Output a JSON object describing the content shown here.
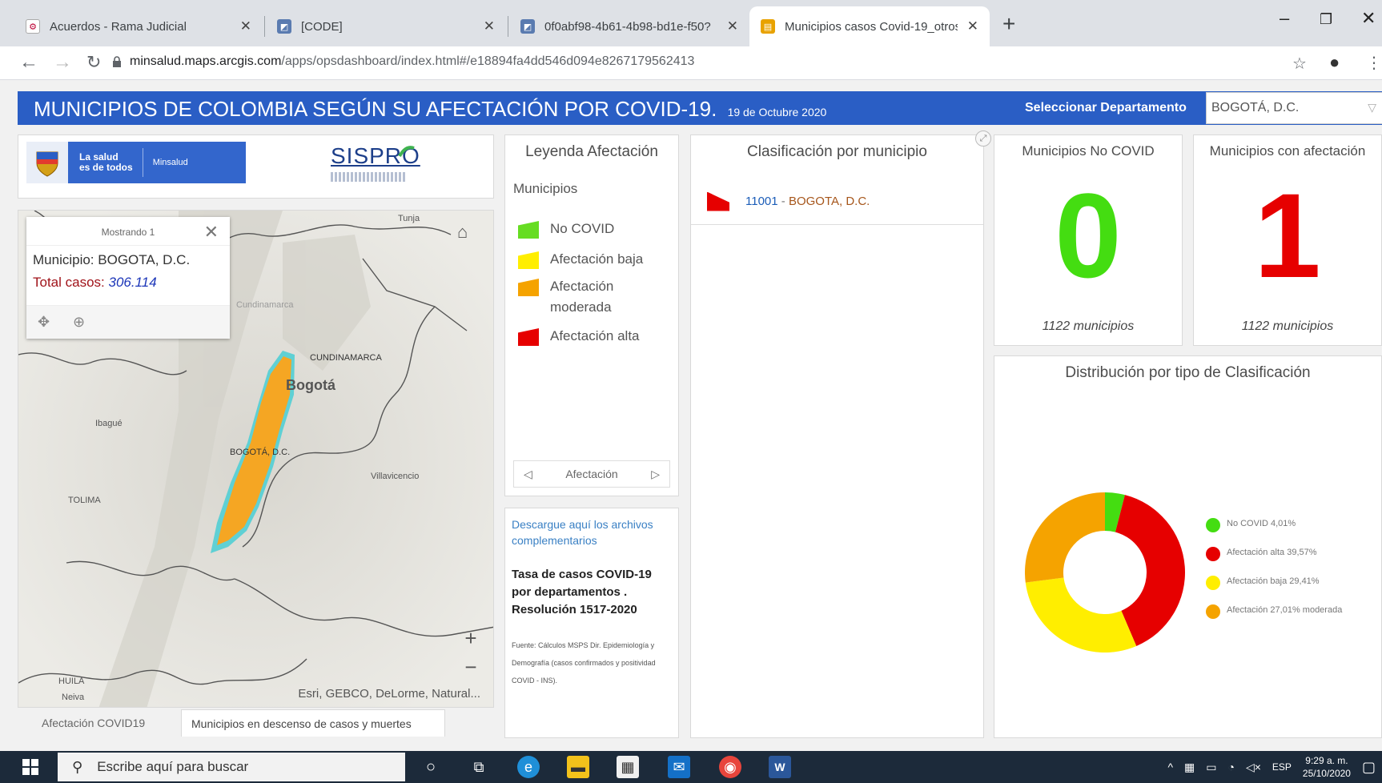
{
  "browser": {
    "tabs": [
      {
        "title": "Acuerdos - Rama Judicial"
      },
      {
        "title": "[CODE]"
      },
      {
        "title": "0f0abf98-4b61-4b98-bd1e-f50?"
      },
      {
        "title": "Municipios casos Covid-19_otros"
      }
    ],
    "url_host": "minsalud.maps.arcgis.com",
    "url_path": "/apps/opsdashboard/index.html#/e18894fa4dd546d094e8267179562413"
  },
  "header": {
    "title": "MUNICIPIOS DE COLOMBIA SEGÚN SU AFECTACIÓN POR COVID-19.",
    "date": "19 de Octubre 2020",
    "dept_label": "Seleccionar Departamento",
    "dept_value": "BOGOTÁ, D.C."
  },
  "logos": {
    "minsalud_line1": "La salud",
    "minsalud_line2": "es de todos",
    "minsalud_brand": "Minsalud",
    "sispro": "SISPRO"
  },
  "popup": {
    "header": "Mostrando 1",
    "municipio": "Municipio: BOGOTA, D.C.",
    "cases_label": "Total casos:",
    "cases_value": "306.114"
  },
  "map": {
    "labels": [
      "Tunja",
      "Cundinamarca",
      "CUNDINAMARCA",
      "Bogotá",
      "BOGOTÁ, D.C.",
      "Villavicencio",
      "Ibagué",
      "TOLIMA",
      "HUILA",
      "Neiva"
    ],
    "attribution": "Esri, GEBCO, DeLorme, Natural..."
  },
  "map_tabs": [
    "Afectación COVID19",
    "Municipios en descenso de casos y muertes"
  ],
  "legend": {
    "title": "Leyenda Afectación",
    "subtitle": "Municipios",
    "items": [
      {
        "label": "No COVID",
        "color": "#66dd22"
      },
      {
        "label": "Afectación baja",
        "color": "#ffee00"
      },
      {
        "label": "Afectación moderada",
        "color": "#f5a300"
      },
      {
        "label": "Afectación alta",
        "color": "#e60000"
      }
    ],
    "nav_label": "Afectación"
  },
  "download": {
    "link": "Descargue aquí los archivos complementarios",
    "heading": "Tasa de casos COVID-19 por departamentos . Resolución 1517-2020",
    "source": "Fuente: Cálculos MSPS Dir. Epidemiología y Demografía (casos confirmados y positividad COVID - INS)."
  },
  "list": {
    "title": "Clasificación por municipio",
    "rows": [
      {
        "code": "11001",
        "name": "BOGOTA, D.C."
      }
    ]
  },
  "indicators": [
    {
      "title": "Municipios No COVID",
      "value": "0",
      "footer": "1122 municipios",
      "color": "#44dd11"
    },
    {
      "title": "Municipios con afectación",
      "value": "1",
      "footer": "1122 municipios",
      "color": "#e60000"
    }
  ],
  "chart_data": {
    "type": "pie",
    "title": "Distribución por tipo de Clasificación",
    "donut": true,
    "series": [
      {
        "name": "No COVID",
        "label": "No COVID 4,01%",
        "value": 4.01,
        "color": "#44dd11"
      },
      {
        "name": "Afectación alta",
        "label": "Afectación alta 39,57%",
        "value": 39.57,
        "color": "#e60000"
      },
      {
        "name": "Afectación baja",
        "label": "Afectación baja 29,41%",
        "value": 29.41,
        "color": "#ffee00"
      },
      {
        "name": "Afectación moderada",
        "label": "Afectación 27,01% moderada",
        "value": 27.01,
        "color": "#f5a300"
      }
    ]
  },
  "taskbar": {
    "search_placeholder": "Escribe aquí para buscar",
    "lang": "ESP",
    "time": "9:29 a. m.",
    "date": "25/10/2020"
  }
}
